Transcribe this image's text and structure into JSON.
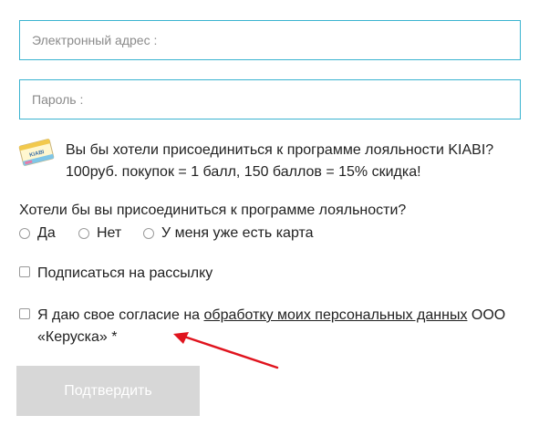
{
  "form": {
    "email": {
      "placeholder": "Электронный адрес :",
      "value": ""
    },
    "password": {
      "placeholder": "Пароль :",
      "value": ""
    },
    "loyalty_promo": {
      "card_logo": "KIABI",
      "line1": "Вы бы хотели присоединиться к программе лояльности KIABI?",
      "line2": "100руб. покупок = 1 балл, 150 баллов = 15% скидка!"
    },
    "loyalty_question": {
      "label": "Хотели бы вы присоединиться к программе лояльности?",
      "options": [
        "Да",
        "Нет",
        "У меня уже есть карта"
      ]
    },
    "newsletter": {
      "label": "Подписаться на рассылку",
      "checked": false
    },
    "consent": {
      "prefix": "Я даю свое согласие на ",
      "link": "обработку моих персональных данных",
      "suffix": " ООО «Керуска» *",
      "checked": false
    },
    "submit_label": "Подтвердить"
  },
  "colors": {
    "input_border": "#3ab3d0",
    "annotation_arrow": "#e0141e",
    "submit_disabled_bg": "#d7d7d7"
  }
}
